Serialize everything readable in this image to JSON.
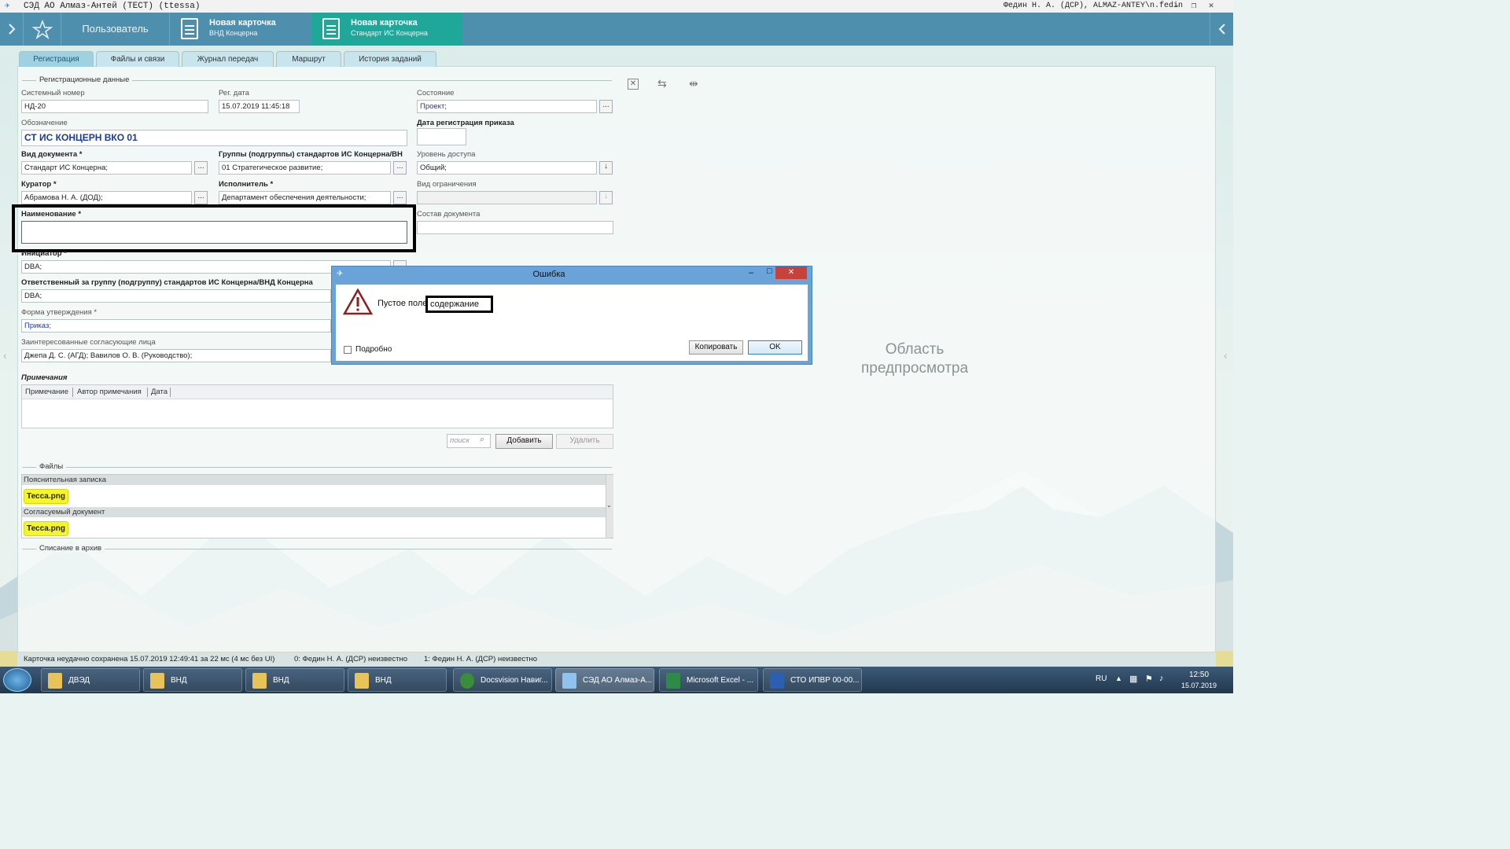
{
  "window": {
    "title": "СЭД АО Алмаз-Антей (ТЕСТ) (ttessa)",
    "user": "Федин Н. А. (ДСР), ALMAZ-ANTEY\\n.fedin"
  },
  "nav": {
    "user_btn": "Пользователь",
    "card1_title": "Новая карточка",
    "card1_sub": "ВНД Концерна",
    "card2_title": "Новая карточка",
    "card2_sub": "Стандарт ИС Концерна"
  },
  "tabs": [
    "Регистрация",
    "Файлы и связи",
    "Журнал передач",
    "Маршрут",
    "История заданий"
  ],
  "form": {
    "section_reg": "Регистрационные данные",
    "sysnum_label": "Системный номер",
    "sysnum": "НД-20",
    "regdate_label": "Рег. дата",
    "regdate": "15.07.2019  11:45:18",
    "state_label": "Состояние",
    "state": "Проект;",
    "designation_label": "Обозначение",
    "designation": "СТ ИС КОНЦЕРН ВКО 01",
    "orderdate_label": "Дата регистрация приказа",
    "doctype_label": "Вид документа  *",
    "doctype": "Стандарт ИС Концерна;",
    "groups_label": "Группы (подгруппы) стандартов ИС Концерна/ВН",
    "groups": "01 Стратегическое развитие;",
    "access_label": "Уровень доступа",
    "access": "Общий;",
    "curator_label": "Куратор  *",
    "curator": "Абрамова Н. А. (ДОД);",
    "executor_label": "Исполнитель  *",
    "executor": "Департамент обеспечения деятельности;",
    "restriction_label": "Вид ограничения",
    "name_label": "Наименование  *",
    "composition_label": "Состав документа",
    "initiator_label": "Инициатор  *",
    "initiator": "DBA;",
    "responsible_label": "Ответственный за группу (подгруппу) стандартов ИС Концерна/ВНД Концерна",
    "responsible": "DBA;",
    "approval_label": "Форма утверждения  *",
    "approval": "Приказ;",
    "interested_label": "Заинтересованные согласующие лица",
    "interested": "Джепа Д. С. (АГД); Вавилов О. В. (Руководство);",
    "notes_label": "Примечания",
    "notes_cols": [
      "Примечание",
      "Автор примечания",
      "Дата"
    ],
    "search_placeholder": "поиск",
    "add": "Добавить",
    "delete": "Удалить",
    "files_label": "Файлы",
    "file_group1": "Пояснительная записка",
    "file1": "Тесса.png",
    "file_group2": "Согласуемый документ",
    "file2": "Тесса.png",
    "archive_label": "Списание в архив"
  },
  "preview": {
    "line1": "Область",
    "line2": "предпросмотра"
  },
  "dialog": {
    "title": "Ошибка",
    "message": "Пустое поле",
    "highlight": "содержание",
    "details": "Подробно",
    "copy": "Копировать",
    "ok": "OK"
  },
  "status": {
    "saved": "Карточка неудачно сохранена 15.07.2019 12:49:41 за 22 мс (4 мс без UI)",
    "u0": "0:  Федин Н. А. (ДСР)  неизвестно",
    "u1": "1:  Федин Н. А. (ДСР)  неизвестно"
  },
  "taskbar": {
    "items": [
      "ДВЭД",
      "ВНД",
      "ВНД",
      "ВНД",
      "Docsvision Навиг...",
      "СЭД АО Алмаз-А...",
      "Microsoft Excel - ...",
      "СТО ИПВР 00-00..."
    ],
    "lang": "RU",
    "time": "12:50",
    "date": "15.07.2019"
  }
}
